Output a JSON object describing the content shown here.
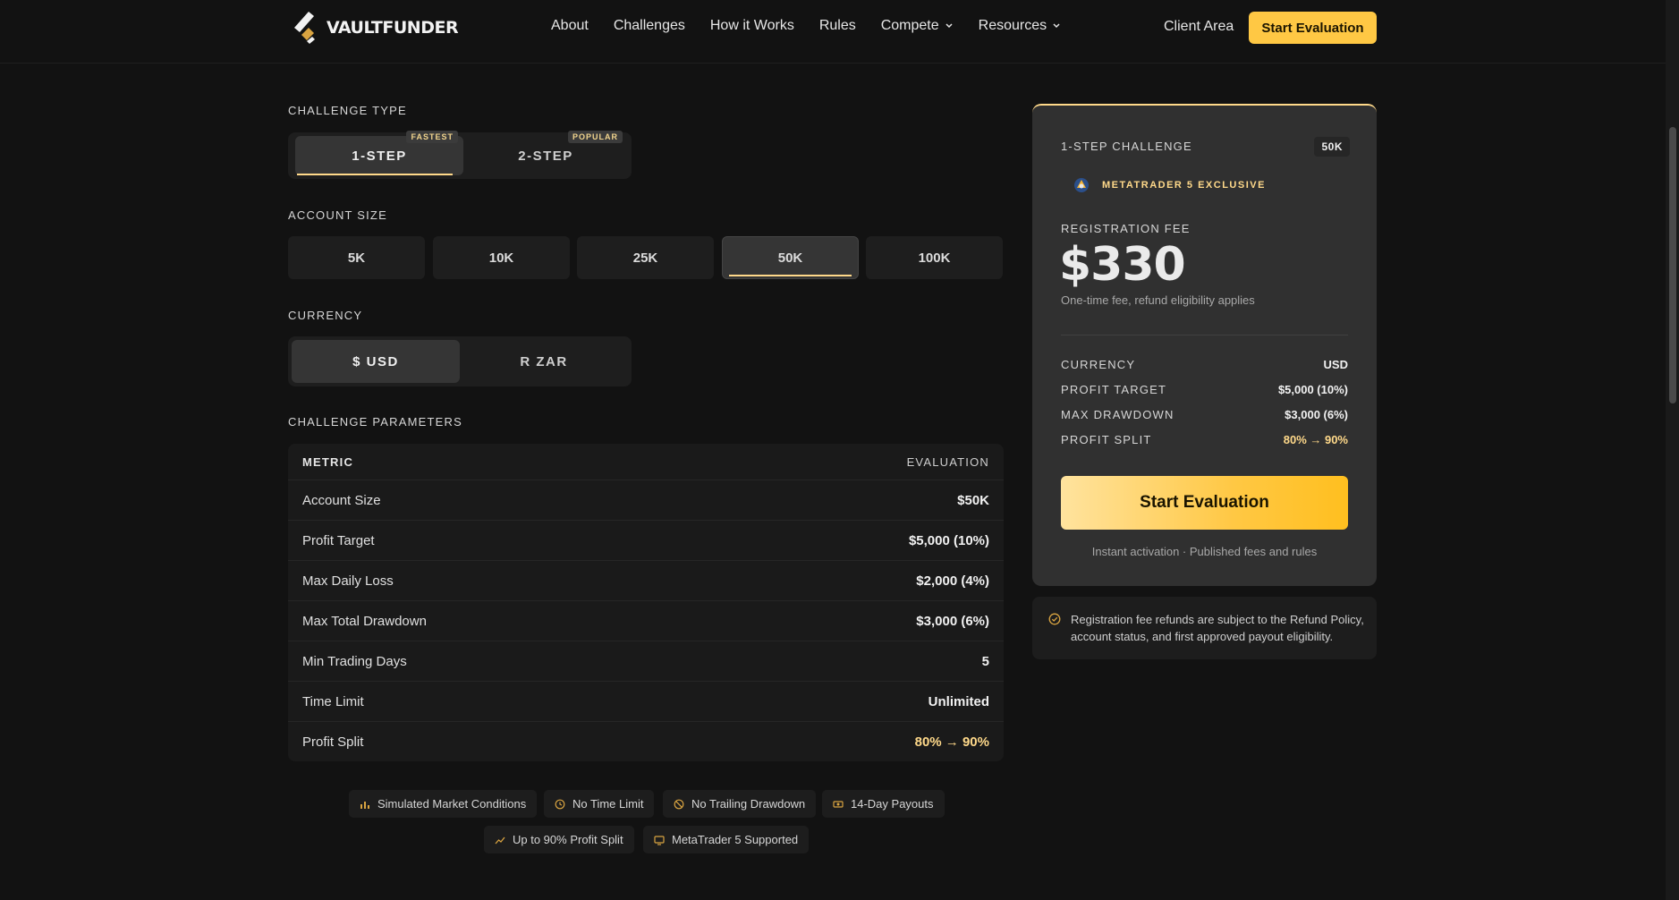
{
  "header": {
    "brand": "VAULTFUNDER",
    "nav": [
      {
        "label": "About",
        "dropdown": false
      },
      {
        "label": "Challenges",
        "dropdown": false
      },
      {
        "label": "How it Works",
        "dropdown": false
      },
      {
        "label": "Rules",
        "dropdown": false
      },
      {
        "label": "Compete",
        "dropdown": true
      },
      {
        "label": "Resources",
        "dropdown": true
      }
    ],
    "client_area": "Client Area",
    "cta": "Start Evaluation"
  },
  "challenge_type": {
    "label": "CHALLENGE TYPE",
    "options": [
      {
        "label": "1-STEP",
        "tag": "FASTEST",
        "active": true
      },
      {
        "label": "2-STEP",
        "tag": "POPULAR",
        "active": false
      }
    ]
  },
  "account_size": {
    "label": "ACCOUNT SIZE",
    "options": [
      "5K",
      "10K",
      "25K",
      "50K",
      "100K"
    ],
    "selected": "50K"
  },
  "currency": {
    "label": "CURRENCY",
    "options": [
      {
        "label": "$ USD",
        "active": true
      },
      {
        "label": "R ZAR",
        "active": false
      }
    ]
  },
  "parameters": {
    "label": "CHALLENGE PARAMETERS",
    "col_metric": "METRIC",
    "col_evaluation": "EVALUATION",
    "rows": [
      {
        "metric": "Account Size",
        "value": "$50K"
      },
      {
        "metric": "Profit Target",
        "value": "$5,000 (10%)"
      },
      {
        "metric": "Max Daily Loss",
        "value": "$2,000 (4%)"
      },
      {
        "metric": "Max Total Drawdown",
        "value": "$3,000 (6%)"
      },
      {
        "metric": "Min Trading Days",
        "value": "5"
      },
      {
        "metric": "Time Limit",
        "value": "Unlimited"
      },
      {
        "metric": "Profit Split",
        "value": "80% → 90%"
      }
    ]
  },
  "features": [
    {
      "label": "Simulated Market Conditions",
      "icon": "bar-chart-icon"
    },
    {
      "label": "No Time Limit",
      "icon": "clock-icon"
    },
    {
      "label": "No Trailing Drawdown",
      "icon": "ban-icon"
    },
    {
      "label": "14-Day Payouts",
      "icon": "cash-icon"
    },
    {
      "label": "Up to 90% Profit Split",
      "icon": "trend-up-icon"
    },
    {
      "label": "MetaTrader 5 Supported",
      "icon": "monitor-icon"
    }
  ],
  "summary": {
    "title": "1-STEP CHALLENGE",
    "badge": "50K",
    "platform": "METATRADER 5 EXCLUSIVE",
    "fee_label": "REGISTRATION FEE",
    "fee": "$330",
    "fee_note": "One-time fee, refund eligibility applies",
    "details": [
      {
        "key": "CURRENCY",
        "value": "USD"
      },
      {
        "key": "PROFIT TARGET",
        "value": "$5,000 (10%)"
      },
      {
        "key": "MAX DRAWDOWN",
        "value": "$3,000 (6%)"
      },
      {
        "key": "PROFIT SPLIT",
        "value": "80% → 90%"
      }
    ],
    "cta": "Start Evaluation",
    "footnote": "Instant activation · Published fees and rules"
  },
  "refund_notice": "Registration fee refunds are subject to the Refund Policy, account status, and first approved payout eligibility.",
  "colors": {
    "accent": "#ffc844",
    "accent_light": "#ffd98a",
    "background": "#121212",
    "card": "#303030"
  }
}
